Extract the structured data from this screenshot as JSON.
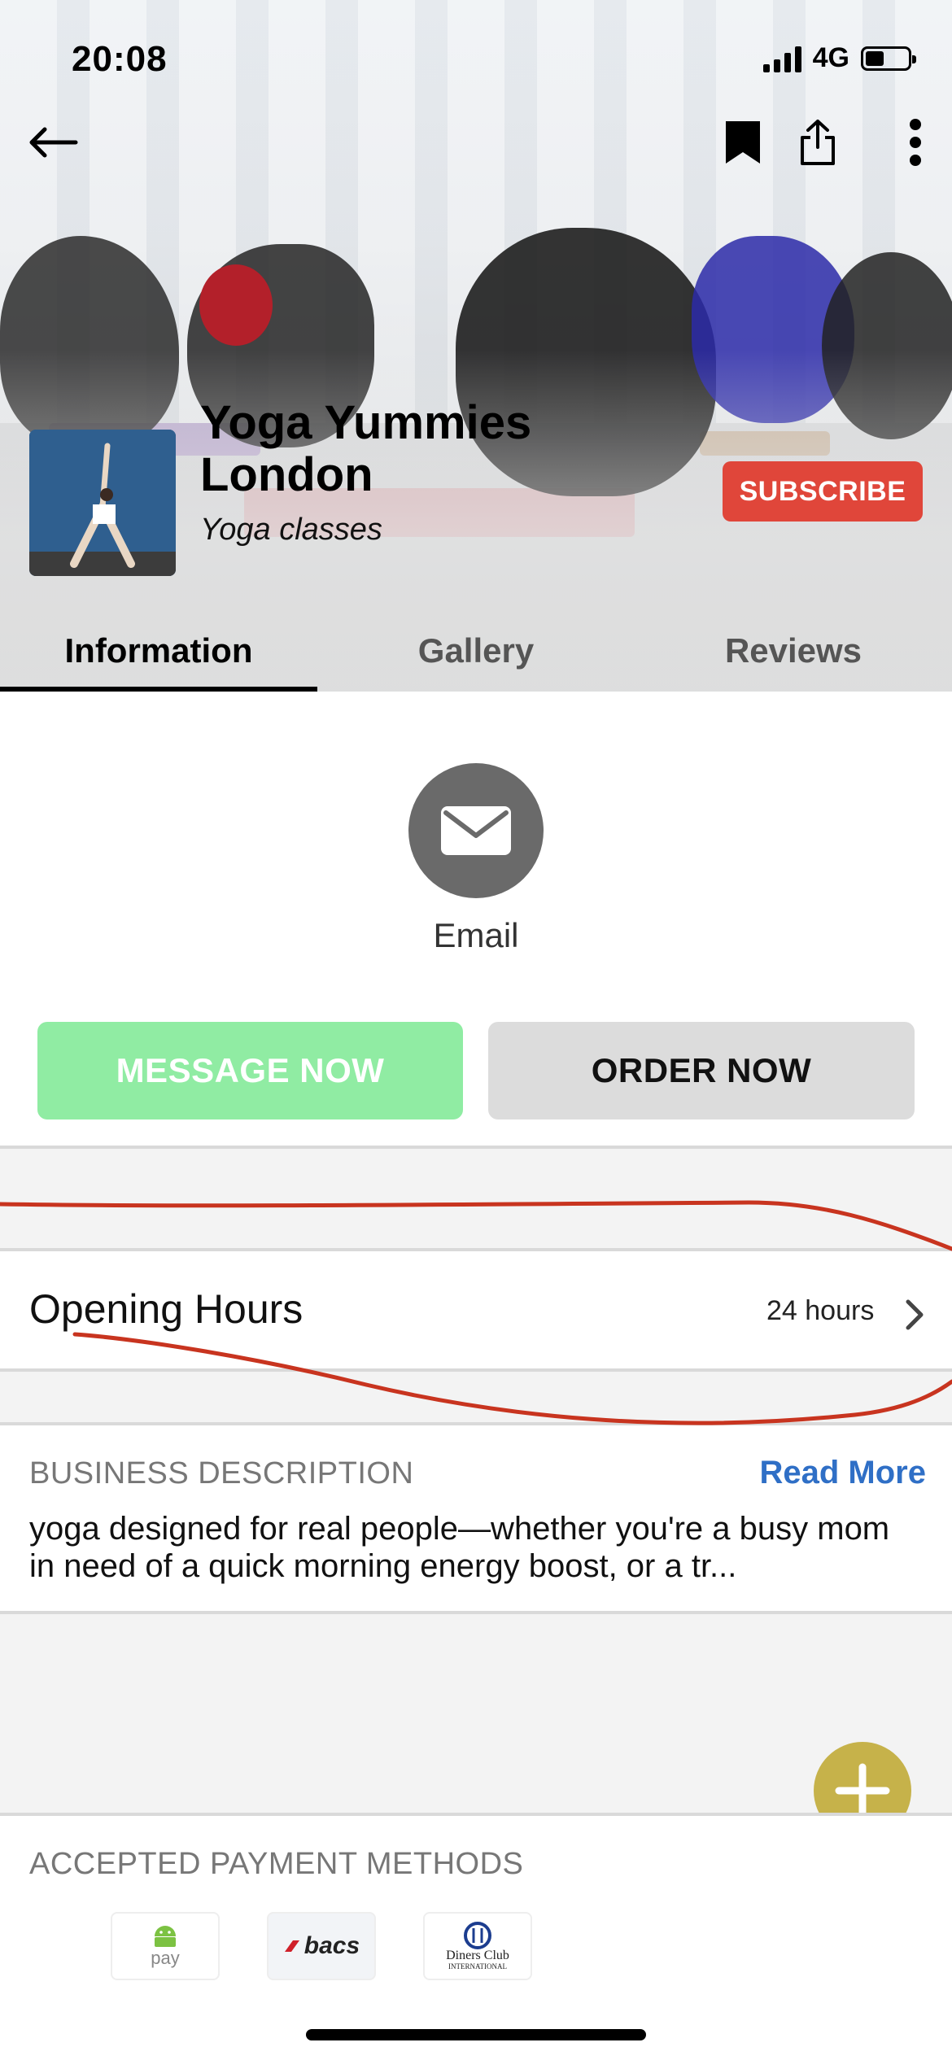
{
  "status_bar": {
    "time": "20:08",
    "network": "4G",
    "battery_level": 0.4
  },
  "toolbar": {
    "back_icon": "arrow-left-icon",
    "bookmark_icon": "bookmark-icon",
    "share_icon": "share-icon",
    "more_icon": "more-vertical-icon"
  },
  "business": {
    "name": "Yoga Yummies London",
    "category": "Yoga classes",
    "subscribe_label": "SUBSCRIBE"
  },
  "tabs": [
    {
      "label": "Information",
      "active": true
    },
    {
      "label": "Gallery",
      "active": false
    },
    {
      "label": "Reviews",
      "active": false
    }
  ],
  "contact": {
    "email_label": "Email"
  },
  "actions": {
    "message_label": "MESSAGE NOW",
    "order_label": "ORDER NOW"
  },
  "opening_hours": {
    "label": "Opening Hours",
    "value": "24 hours"
  },
  "description": {
    "heading": "BUSINESS DESCRIPTION",
    "read_more": "Read More",
    "text": "yoga designed for real people—whether you're a busy mom in need of a quick morning energy boost, or a tr..."
  },
  "payment": {
    "heading": "ACCEPTED PAYMENT METHODS",
    "methods": [
      {
        "name": "android-pay",
        "label": "pay"
      },
      {
        "name": "bacs",
        "label": "bacs"
      },
      {
        "name": "diners-club",
        "label": "Diners Club",
        "sublabel": "INTERNATIONAL"
      }
    ]
  },
  "colors": {
    "subscribe": "#e0463a",
    "message_button": "#90eca3",
    "order_button": "#dcdcdc",
    "link": "#2f6fc6",
    "fab": "#c6b24a",
    "annotation": "#c8341f"
  }
}
